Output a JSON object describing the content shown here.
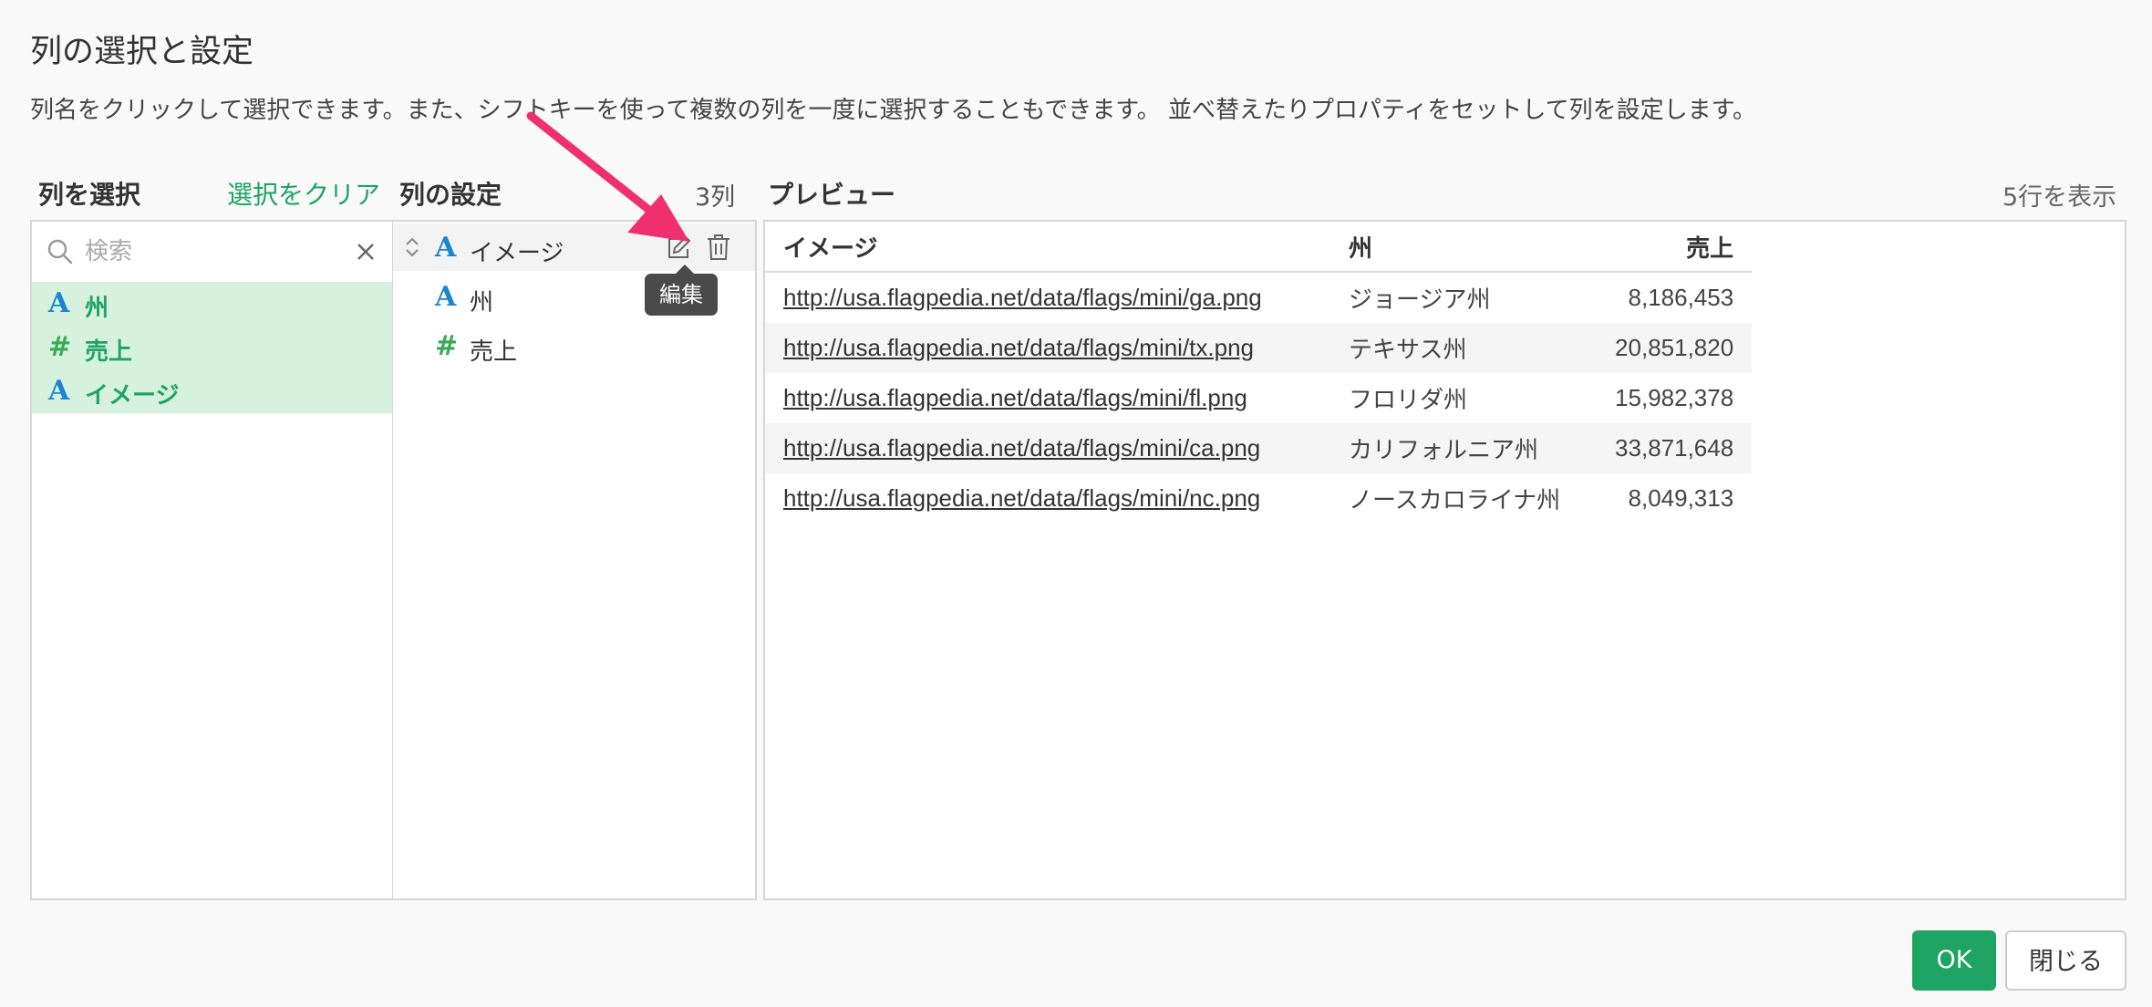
{
  "dialog": {
    "title": "列の選択と設定",
    "description": "列名をクリックして選択できます。また、シフトキーを使って複数の列を一度に選択することもできます。 並べ替えたりプロパティをセットして列を設定します。"
  },
  "select_columns": {
    "heading": "列を選択",
    "clear_label": "選択をクリア",
    "search_placeholder": "検索",
    "items": [
      {
        "type_symbol": "A",
        "type": "character",
        "label": "州"
      },
      {
        "type_symbol": "#",
        "type": "numeric",
        "label": "売上"
      },
      {
        "type_symbol": "A",
        "type": "character",
        "label": "イメージ"
      }
    ]
  },
  "column_settings": {
    "heading": "列の設定",
    "count_label": "3列",
    "items": [
      {
        "type_symbol": "A",
        "type": "character",
        "label": "イメージ"
      },
      {
        "type_symbol": "A",
        "type": "character",
        "label": "州"
      },
      {
        "type_symbol": "#",
        "type": "numeric",
        "label": "売上"
      }
    ],
    "edit_tooltip": "編集"
  },
  "preview": {
    "heading": "プレビュー",
    "rows_label": "5行を表示",
    "columns": [
      "イメージ",
      "州",
      "売上"
    ],
    "rows": [
      [
        "http://usa.flagpedia.net/data/flags/mini/ga.png",
        "ジョージア州",
        "8,186,453"
      ],
      [
        "http://usa.flagpedia.net/data/flags/mini/tx.png",
        "テキサス州",
        "20,851,820"
      ],
      [
        "http://usa.flagpedia.net/data/flags/mini/fl.png",
        "フロリダ州",
        "15,982,378"
      ],
      [
        "http://usa.flagpedia.net/data/flags/mini/ca.png",
        "カリフォルニア州",
        "33,871,648"
      ],
      [
        "http://usa.flagpedia.net/data/flags/mini/nc.png",
        "ノースカロライナ州",
        "8,049,313"
      ]
    ]
  },
  "buttons": {
    "ok": "OK",
    "close": "閉じる"
  },
  "colors": {
    "accent": "#1fa463",
    "character_type": "#1a86d0",
    "numeric_type": "#3aaa55",
    "annotation_arrow": "#f0306e"
  }
}
